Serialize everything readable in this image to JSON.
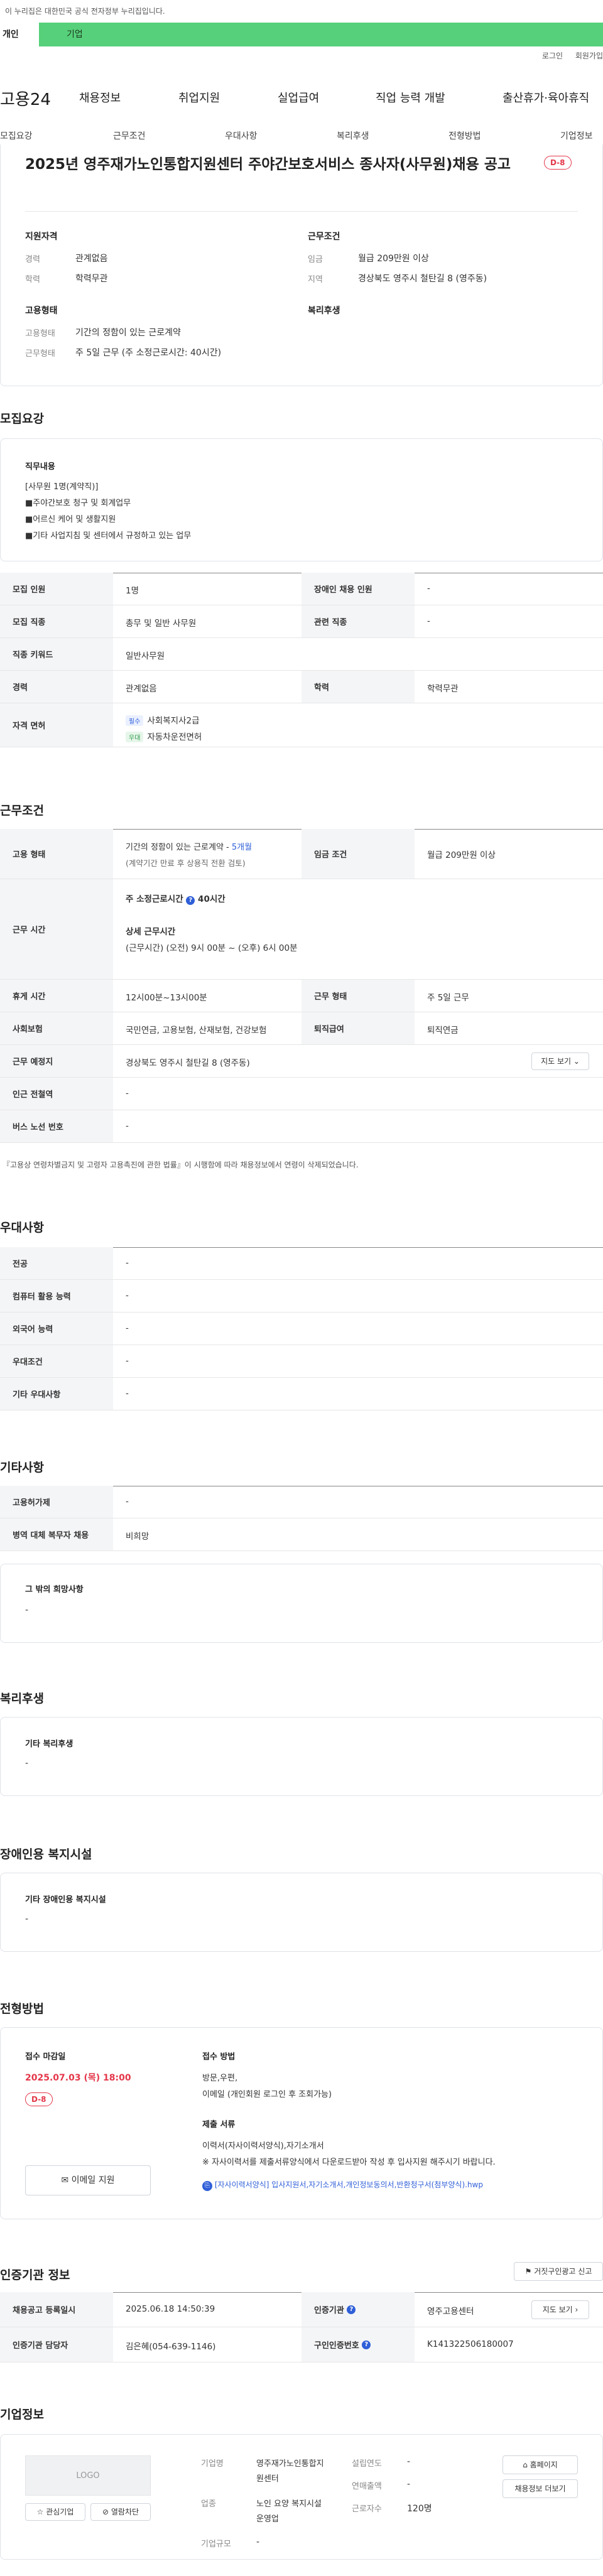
{
  "notice": "이 누리집은 대한민국 공식 전자정부 누리집입니다.",
  "tabs": {
    "personal": "개인",
    "company": "기업"
  },
  "util": {
    "login": "로그인",
    "join": "회원가입"
  },
  "brand": "고용24",
  "gnb": [
    "채용정보",
    "취업지원",
    "실업급여",
    "직업 능력 개발",
    "출산휴가·육아휴직"
  ],
  "subnav": [
    "모집요강",
    "근무조건",
    "우대사항",
    "복리후생",
    "전형방법",
    "기업정보"
  ],
  "job": {
    "title": "2025년 영주재가노인통합지원센터 주야간보호서비스 종사자(사무원)채용 공고",
    "dday": "D-8",
    "qual_title": "지원자격",
    "career_k": "경력",
    "career_v": "관계없음",
    "edu_k": "학력",
    "edu_v": "학력무관",
    "work_title": "근무조건",
    "wage_k": "임금",
    "wage_v": "월급 209만원 이상",
    "region_k": "지역",
    "region_v": "경상북도 영주시 철탄길 8 (영주동)",
    "emp_title": "고용형태",
    "emptype_k": "고용형태",
    "emptype_v": "기간의 정함이 있는 근로계약",
    "workform_k": "근무형태",
    "workform_v": "주 5일 근무 (주 소정근로시간: 40시간)",
    "welfare_title": "복리후생"
  },
  "recruit": {
    "title": "모집요강",
    "duty_title": "직무내용",
    "duty_lines": [
      "[사무원 1명(계약직)]",
      "■주야간보호 청구  및 회계업무",
      "■어르신 케어 및 생활지원",
      "■기타 사업지침 및 센터에서 규정하고 있는 업무"
    ],
    "rows": {
      "count_k": "모집 인원",
      "count_v": "1명",
      "disabled_k": "장애인 채용 인원",
      "disabled_v": "-",
      "job_k": "모집 직종",
      "job_v": "총무 및 일반 사무원",
      "rel_k": "관련 직종",
      "rel_v": "-",
      "kw_k": "직종 키워드",
      "kw_v": "일반사무원",
      "career_k": "경력",
      "career_v": "관계없음",
      "edu_k": "학력",
      "edu_v": "학력무관",
      "lic_k": "자격 면허",
      "lic_req": "필수",
      "lic_req_v": "사회복지사2급",
      "lic_pref": "우대",
      "lic_pref_v": "자동차운전면허"
    }
  },
  "cond": {
    "title": "근무조건",
    "emp_k": "고용 형태",
    "emp_v1": "기간의 정함이 있는 근로계약 - ",
    "emp_months": "5개월",
    "emp_v2": "(계약기간 만료 후 상용직 전환 검토)",
    "wage_k": "임금 조건",
    "wage_v": "월급 209만원 이상",
    "time_k": "근무 시간",
    "time_main": "주 소정근로시간",
    "time_hours": "40시간",
    "time_detail_t": "상세 근무시간",
    "time_detail_v": "(근무시간) (오전) 9시 00분 ~ (오후) 6시 00분",
    "rest_k": "휴게 시간",
    "rest_v": "12시00분~13시00분",
    "form_k": "근무 형태",
    "form_v": "주 5일 근무",
    "ins_k": "사회보험",
    "ins_v": "국민연금, 고용보험, 산재보험, 건강보험",
    "ret_k": "퇴직급여",
    "ret_v": "퇴직연금",
    "place_k": "근무 예정지",
    "place_v": "경상북도 영주시 철탄길 8 (영주동)",
    "map_btn": "지도 보기",
    "subway_k": "인근 전철역",
    "subway_v": "-",
    "bus_k": "버스 노선 번호",
    "bus_v": "-",
    "note": "『고용상 연령차별금지 및 고령자 고용촉진에 관한 법률』이 시행함에 따라 채용정보에서 연령이 삭제되었습니다."
  },
  "pref": {
    "title": "우대사항",
    "rows": [
      [
        "전공",
        "-"
      ],
      [
        "컴퓨터 활용 능력",
        "-"
      ],
      [
        "외국어 능력",
        "-"
      ],
      [
        "우대조건",
        "-"
      ],
      [
        "기타 우대사항",
        "-"
      ]
    ]
  },
  "etc": {
    "title": "기타사항",
    "rows": [
      [
        "고용허가제",
        "-"
      ],
      [
        "병역 대체 복무자 채용",
        "비희망"
      ]
    ],
    "other_t": "그 밖의 희망사항",
    "other_v": "-"
  },
  "welfare": {
    "title": "복리후생",
    "box_t": "기타 복리후생",
    "box_v": "-"
  },
  "facility": {
    "title": "장애인용 복지시설",
    "box_t": "기타 장애인용 복지시설",
    "box_v": "-"
  },
  "screening": {
    "title": "전형방법",
    "deadline_t": "접수 마감일",
    "deadline_v": "2025.07.03 (목) 18:00",
    "dday": "D-8",
    "method_t": "접수 방법",
    "method_v1": "방문,우편,",
    "method_v2": "이메일 (개인회원 로그인 후 조회가능)",
    "docs_t": "제출 서류",
    "docs_v1": "이력서(자사이력서양식),자기소개서",
    "docs_v2": "※ 자사이력서를 제출서류양식에서 다운로드받아 작성 후 입사지원 해주시기 바랍니다.",
    "file": "[자사이력서양식] 입사지원서,자기소개서,개인정보동의서,반환청구서(첨부양식).hwp",
    "email_btn": "이메일 지원"
  },
  "cert": {
    "title": "인증기관 정보",
    "report_btn": "거짓구인광고 신고",
    "reg_k": "채용공고 등록일시",
    "reg_v": "2025.06.18 14:50:39",
    "org_k": "인증기관",
    "org_v": "영주고용센터",
    "map_btn": "지도 보기",
    "mgr_k": "인증기관 담당자",
    "mgr_v": "김은혜(054-639-1146)",
    "no_k": "구인인증번호",
    "no_v": "K141322506180007"
  },
  "company": {
    "title": "기업정보",
    "logo": "LOGO",
    "fav_btn": "관심기업",
    "block_btn": "열람차단",
    "name_k": "기업명",
    "name_v": "영주재가노인통합지원센터",
    "ind_k": "업종",
    "ind_v": "노인 요양 복지시설 운영업",
    "scale_k": "기업규모",
    "scale_v": "-",
    "est_k": "설립연도",
    "est_v": "-",
    "sales_k": "연매출액",
    "sales_v": "-",
    "emp_k": "근로자수",
    "emp_v": "120명",
    "home_btn": "홈페이지",
    "jobs_btn": "채용정보 더보기"
  }
}
